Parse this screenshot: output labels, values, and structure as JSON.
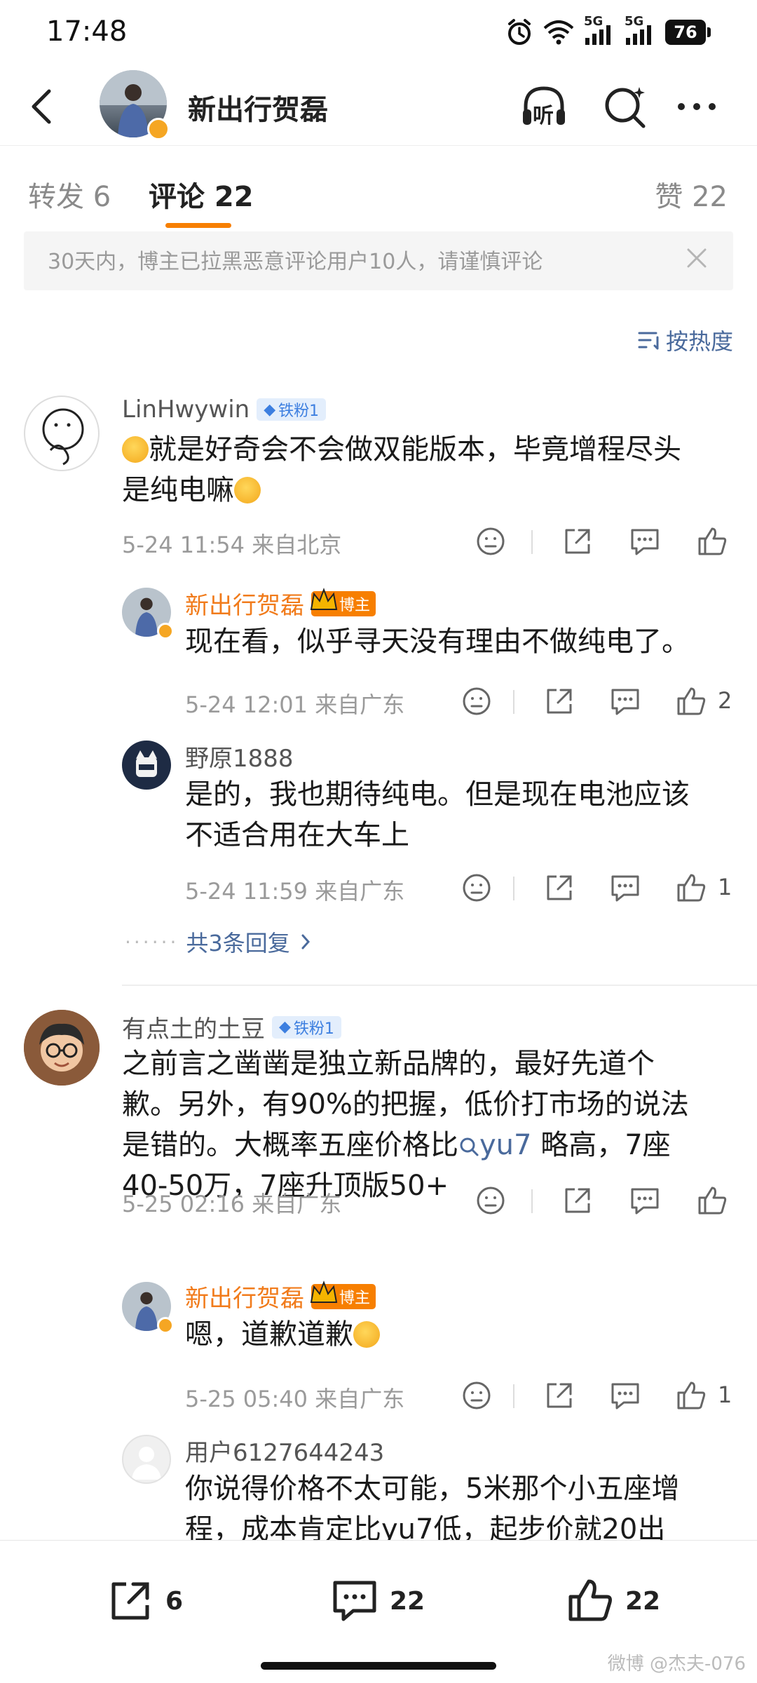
{
  "status_bar": {
    "time": "17:48",
    "network_1": "5G",
    "network_2": "5G",
    "battery": "76"
  },
  "header": {
    "title": "新出行贺磊",
    "back_icon": "back-arrow-icon",
    "listen_label": "听",
    "search_icon": "search-spark-icon",
    "more_icon": "more-dots-icon"
  },
  "tabs": {
    "repost": "转发 6",
    "comments": "评论 22",
    "likes": "赞 22"
  },
  "notice": {
    "text": "30天内，博主已拉黑恶意评论用户10人，请谨慎评论"
  },
  "sort_label": "按热度",
  "comments": [
    {
      "user": "LinHwywin",
      "badge": "铁粉1",
      "text_a": "就是好奇会不会做双能版本，毕竟增程尽头",
      "text_b": "是纯电嘛",
      "meta": "5-24 11:54  来自北京",
      "replies": [
        {
          "user": "新出行贺磊",
          "badge": "博主",
          "text": "现在看，似乎寻天没有理由不做纯电了。",
          "meta": "5-24 12:01  来自广东",
          "likes": "2"
        },
        {
          "user": "野原1888",
          "text_a": "是的，我也期待纯电。但是现在电池应该",
          "text_b": "不适合用在大车上",
          "meta": "5-24 11:59  来自广东",
          "likes": "1"
        }
      ],
      "more_replies": "共3条回复"
    },
    {
      "user": "有点土的土豆",
      "badge": "铁粉1",
      "text_a": "之前言之凿凿是独立新品牌的，最好先道个",
      "text_b": "歉。另外，有90%的把握，低价打市场的说法",
      "text_c_pre": "是错的。大概率五座价格比",
      "text_c_mention": "yu7",
      "text_c_post": " 略高，7座",
      "text_d": "40-50万，7座升顶版50+",
      "meta": "5-25 02:16  来自广东",
      "replies": [
        {
          "user": "新出行贺磊",
          "badge": "博主",
          "text": "嗯，道歉道歉",
          "meta": "5-25 05:40  来自广东",
          "likes": "1"
        },
        {
          "user": "用户6127644243",
          "text_a": "你说得价格不太可能，5米那个小五座增",
          "text_b": "程，成本肯定比yu7低，起步价就20出"
        }
      ]
    }
  ],
  "bottom_bar": {
    "repost_count": "6",
    "comment_count": "22",
    "like_count": "22"
  },
  "watermark": "微博 @杰夫-076"
}
